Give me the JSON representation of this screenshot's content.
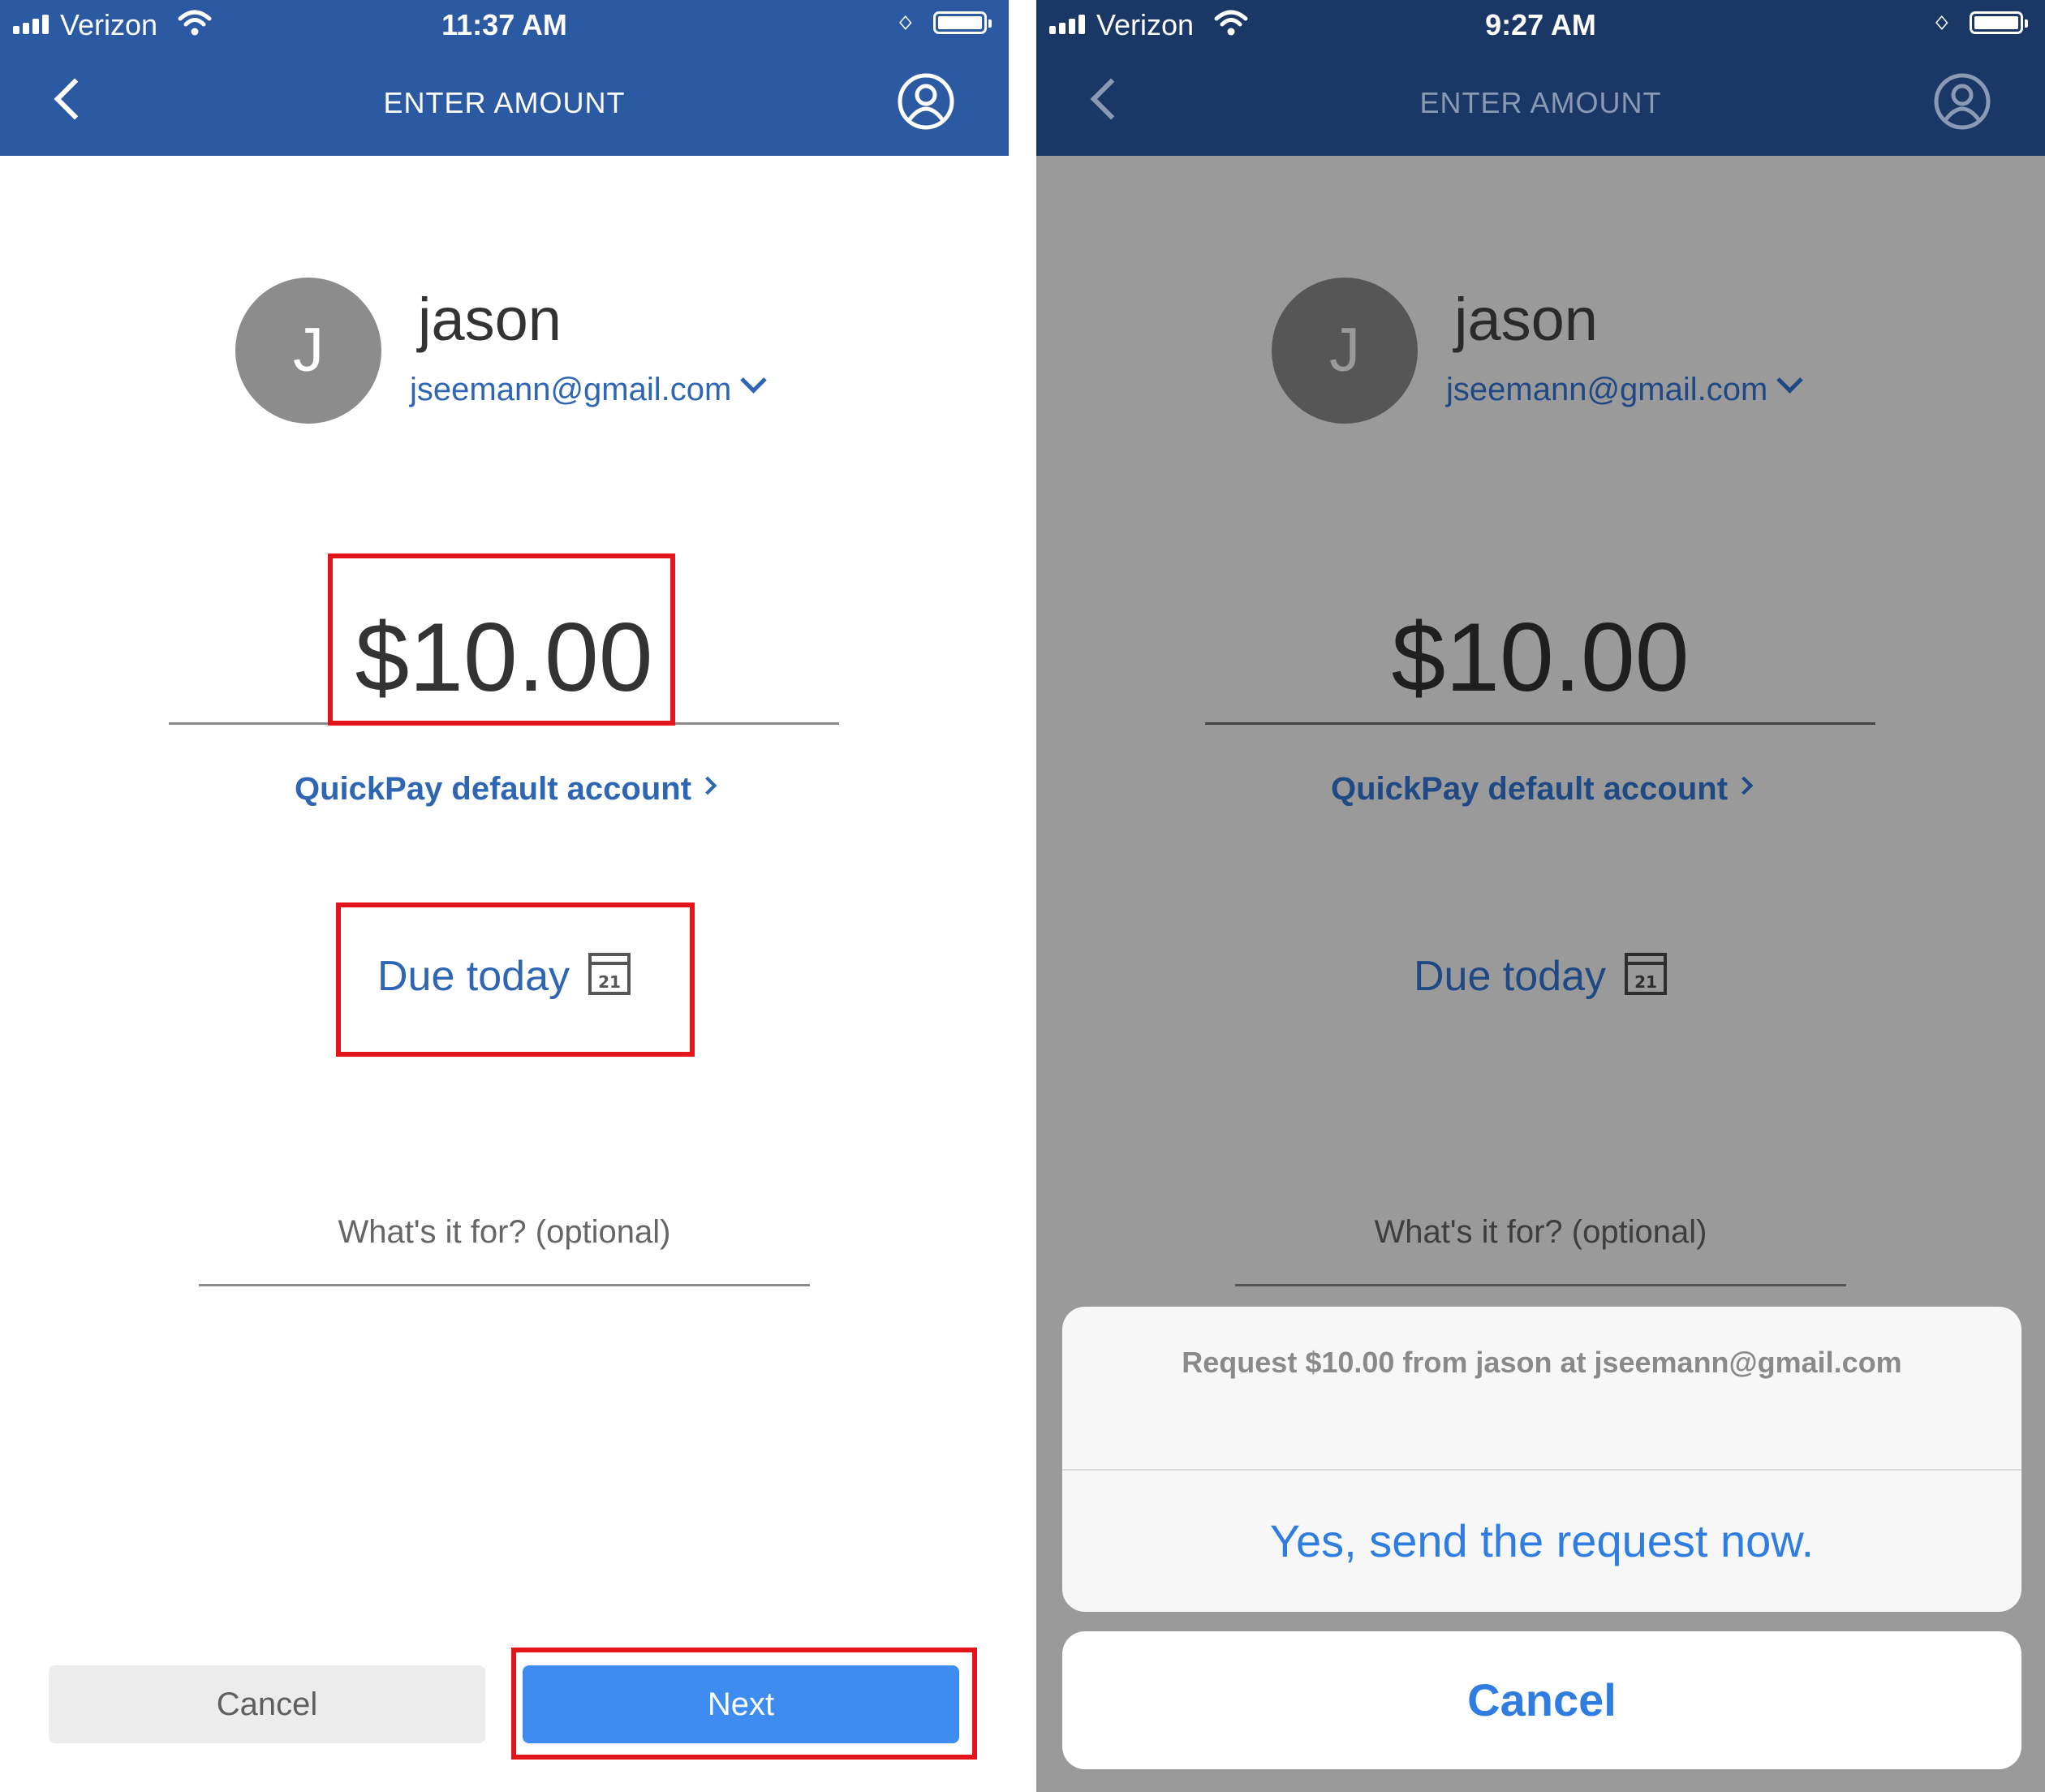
{
  "colors": {
    "header_left": "#2c5aa2",
    "header_right": "#1b3766",
    "link_blue": "#2f66b3",
    "next_button": "#3f8cf0",
    "highlight_red": "#e4141b",
    "sheet_action_blue": "#2f7de1",
    "dim_overlay": "#9a9a9a"
  },
  "left_screen": {
    "status_bar": {
      "carrier": "Verizon",
      "time": "11:37 AM"
    },
    "header": {
      "back_icon": "chevron-left-icon",
      "title": "ENTER AMOUNT",
      "profile_icon": "profile-icon"
    },
    "recipient": {
      "avatar_initial": "J",
      "name": "jason",
      "email": "jseemann@gmail.com"
    },
    "amount": "$10.00",
    "account_link": "QuickPay default account",
    "due_date": {
      "label": "Due today",
      "calendar_day": "21"
    },
    "memo_placeholder": "What's it for? (optional)",
    "buttons": {
      "cancel": "Cancel",
      "next": "Next"
    }
  },
  "right_screen": {
    "status_bar": {
      "carrier": "Verizon",
      "time": "9:27 AM"
    },
    "header": {
      "back_icon": "chevron-left-icon",
      "title": "ENTER AMOUNT",
      "profile_icon": "profile-icon"
    },
    "recipient": {
      "avatar_initial": "J",
      "name": "jason",
      "email": "jseemann@gmail.com"
    },
    "amount": "$10.00",
    "account_link": "QuickPay default account",
    "due_date": {
      "label": "Due today",
      "calendar_day": "21"
    },
    "memo_placeholder": "What's it for? (optional)",
    "action_sheet": {
      "message": "Request $10.00 from jason at jseemann@gmail.com",
      "confirm_action": "Yes, send the request now.",
      "cancel": "Cancel"
    }
  }
}
